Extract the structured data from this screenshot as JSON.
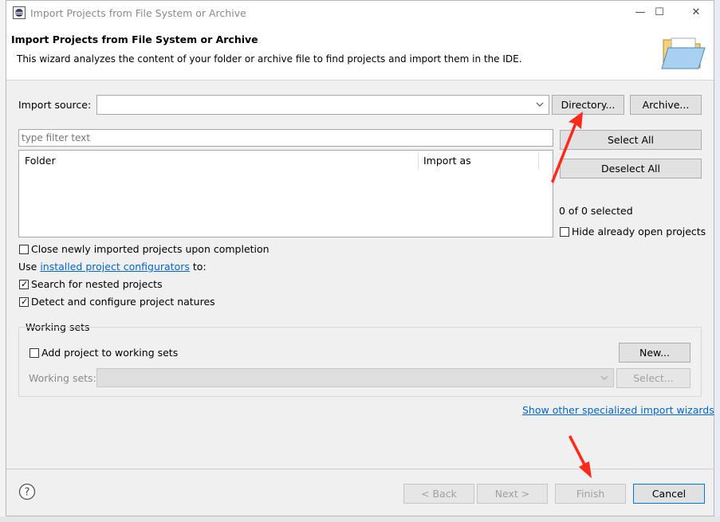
{
  "window": {
    "title": "Import Projects from File System or Archive",
    "controls": {
      "minimize": "—",
      "maximize": "☐",
      "close": "✕"
    }
  },
  "header": {
    "title": "Import Projects from File System or Archive",
    "description": "This wizard analyzes the content of your folder or archive file to find projects and import them in the IDE."
  },
  "import_source": {
    "label": "Import source:",
    "value": "",
    "directory_button": "Directory...",
    "archive_button": "Archive..."
  },
  "filter": {
    "placeholder": "type filter text"
  },
  "table": {
    "columns": [
      "Folder",
      "Import as"
    ],
    "rows": []
  },
  "side_buttons": {
    "select_all": "Select All",
    "deselect_all": "Deselect All",
    "selected_count": "0 of 0 selected",
    "hide_open": {
      "label": "Hide already open projects",
      "checked": false
    }
  },
  "options": {
    "close_imported": {
      "label": "Close newly imported projects upon completion",
      "checked": false
    },
    "use_prefix": "Use ",
    "configurators_link": "installed project configurators",
    "use_suffix": " to:",
    "search_nested": {
      "label": "Search for nested projects",
      "checked": true
    },
    "detect_natures": {
      "label": "Detect and configure project natures",
      "checked": true
    }
  },
  "working_sets": {
    "group_label": "Working sets",
    "add_to_sets": {
      "label": "Add project to working sets",
      "checked": false
    },
    "new_button": "New...",
    "sets_label": "Working sets:",
    "sets_value": "",
    "select_button": "Select..."
  },
  "other_wizards_link": "Show other specialized import wizards",
  "footer": {
    "help_icon": "?",
    "back": "< Back",
    "next": "Next >",
    "finish": "Finish",
    "cancel": "Cancel"
  },
  "colors": {
    "accent_link": "#0066cc",
    "annotation_arrow": "#ff2a1a"
  }
}
